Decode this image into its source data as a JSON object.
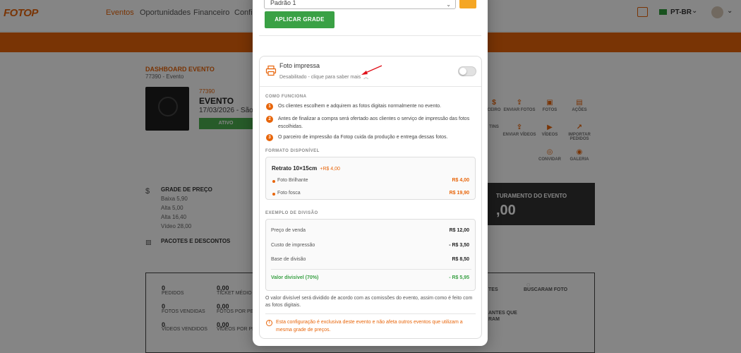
{
  "nav": {
    "logo": "FOTOP",
    "items": [
      "Eventos",
      "Oportunidades",
      "Financeiro",
      "Confi"
    ],
    "language": "PT-BR"
  },
  "background": {
    "dashboard_title": "DASHBOARD EVENTO",
    "dashboard_sub": "77390 - Evento",
    "event_id": "77390",
    "event_name": "EVENTO",
    "event_date": "17/03/2026 - São",
    "status_button": "ATIVO",
    "actions": [
      "CEIRO",
      "ENVIAR FOTOS",
      "FOTOS",
      "AÇÕES",
      "TINS",
      "ENVIAR VÍDEOS",
      "VÍDEOS",
      "IMPORTAR PEDIDOS",
      "CONVIDAR",
      "GALERIA"
    ],
    "price_grid_title": "GRADE DE PREÇO",
    "price_grid": [
      "Baixa 5,90",
      "Alta 5,00",
      "Alta 16,40",
      "Vídeo 28,00"
    ],
    "packages_title": "PACOTES E DESCONTOS",
    "revenue_title": "TURAMENTO DO EVENTO",
    "revenue_value": ",00",
    "stats": [
      {
        "value": "0",
        "label": "PEDIDOS"
      },
      {
        "value": "0,00",
        "label": "TICKET MÉDIO"
      },
      {
        "value": "0",
        "label": "FOTOS VENDIDAS"
      },
      {
        "value": "0,00",
        "label": "FOTOS POR PE"
      },
      {
        "value": "0",
        "label": "VÍDEOS VENDIDOS"
      },
      {
        "value": "0,00",
        "label": "VÍDEOS POR PE"
      }
    ],
    "stats_right": [
      "TES",
      "BUSCARAM FOTO",
      "ANTES QUE",
      "RAM"
    ]
  },
  "modal": {
    "select_value": "Padrão 1",
    "apply_button": "APLICAR GRADE",
    "card": {
      "title": "Foto impressa",
      "subtitle": "Desabilitado - clique para saber mais",
      "toggle_on": false,
      "how_title": "COMO FUNCIONA",
      "steps": [
        {
          "num": "1",
          "text": "Os clientes escolhem e adquirem as fotos digitais normalmente no evento."
        },
        {
          "num": "2",
          "text": "Antes de finalizar a compra será ofertado aos clientes o serviço de impressão das fotos escolhidas."
        },
        {
          "num": "3",
          "text": "O parceiro de impressão da Fotop cuida da produção e entrega dessas fotos."
        }
      ],
      "format_title": "FORMATO DISPONÍVEL",
      "format_name": "Retrato 10×15cm",
      "format_price": "+R$ 4,00",
      "format_options": [
        {
          "name": "Foto Brilhante",
          "price": "R$ 4,00"
        },
        {
          "name": "Foto fosca",
          "price": "R$ 19,90"
        }
      ],
      "division_title": "EXEMPLO DE DIVISÃO",
      "division_rows": [
        {
          "label": "Preço de venda",
          "value": "R$ 12,00"
        },
        {
          "label": "Custo de impressão",
          "value": "- R$ 3,50"
        },
        {
          "label": "Base de divisão",
          "value": "R$ 8,50"
        }
      ],
      "division_total_label": "Valor divisível (70%)",
      "division_total_value": "- R$ 5,95",
      "division_note": "O valor divisível será dividido de acordo com as comissões do evento, assim como é feito com as fotos digitais.",
      "warning": "Esta configuração é exclusiva deste evento e não afeta outros eventos que utilizam a mesma grade de preços."
    }
  },
  "colors": {
    "accent": "#e8650a",
    "green": "#3aa145",
    "annotation_arrow": "#e0101a"
  }
}
